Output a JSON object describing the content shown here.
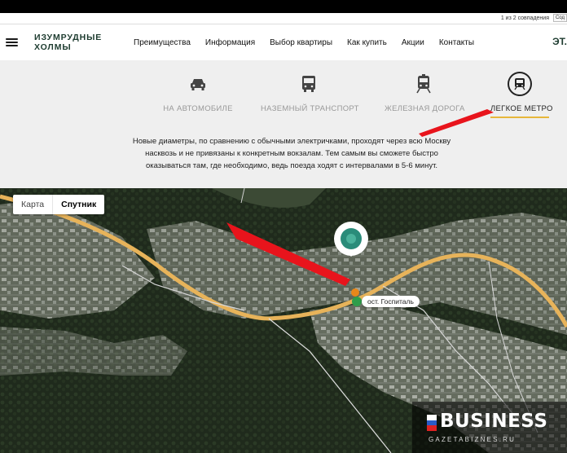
{
  "findbar": {
    "count": "1 из 2 совпадения",
    "extra": "Сод"
  },
  "header": {
    "logo_line1": "ИЗУМРУДНЫЕ",
    "logo_line2": "ХОЛМЫ",
    "nav": [
      "Преимущества",
      "Информация",
      "Выбор квартиры",
      "Как купить",
      "Акции",
      "Контакты"
    ],
    "right_text": "ЭТ."
  },
  "transport": {
    "tabs": [
      {
        "label": "НА АВТОМОБИЛЕ",
        "icon": "car-icon"
      },
      {
        "label": "НАЗЕМНЫЙ ТРАНСПОРТ",
        "icon": "bus-icon"
      },
      {
        "label": "ЖЕЛЕЗНАЯ ДОРОГА",
        "icon": "train-icon"
      },
      {
        "label": "ЛЕГКОЕ МЕТРО",
        "icon": "metro-icon",
        "active": true
      }
    ],
    "description": "Новые диаметры, по сравнению с обычными электричками, проходят через всю Москву насквозь и не привязаны к конкретным вокзалам. Тем самым вы сможете быстро оказываться там, где необходимо, ведь поезда ходят с интервалами в 5-6 минут."
  },
  "map": {
    "toggle_map": "Карта",
    "toggle_satellite": "Спутник",
    "stop_label": "ост. Госпиталь"
  },
  "watermark": {
    "brand": "BUSINESS",
    "site": "GAZETABIZNES.RU"
  },
  "colors": {
    "accent": "#e7b73b",
    "logo_green": "#1d3b2f",
    "arrow_red": "#e8141c",
    "road": "#e7b35a",
    "stop_green": "#2f9d4a"
  }
}
